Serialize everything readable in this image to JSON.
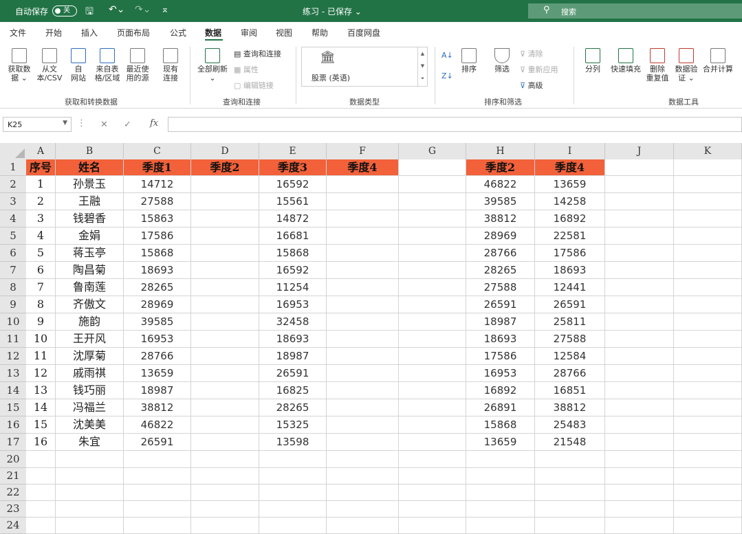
{
  "title_bar": {
    "autosave_label": "自动保存",
    "toggle_state": "关",
    "document_title": "练习 - 已保存 ⌄",
    "search_placeholder": "搜索"
  },
  "menu": {
    "tabs": [
      "文件",
      "开始",
      "插入",
      "页面布局",
      "公式",
      "数据",
      "审阅",
      "视图",
      "帮助",
      "百度网盘"
    ],
    "active_tab": "数据"
  },
  "ribbon": {
    "get_data": {
      "buttons": [
        {
          "line1": "获取数",
          "line2": "据 ⌄"
        },
        {
          "line1": "从文",
          "line2": "本/CSV"
        },
        {
          "line1": "自",
          "line2": "网站"
        },
        {
          "line1": "来自表",
          "line2": "格/区域"
        },
        {
          "line1": "最近使",
          "line2": "用的源"
        },
        {
          "line1": "现有",
          "line2": "连接"
        }
      ],
      "group_label": "获取和转换数据"
    },
    "queries": {
      "refresh_all_line1": "全部刷新",
      "refresh_all_line2": "⌄",
      "queries_connections": "查询和连接",
      "properties": "属性",
      "edit_links": "编辑链接",
      "group_label": "查询和连接"
    },
    "data_types": {
      "stock_label": "股票 (英语)",
      "group_label": "数据类型"
    },
    "sort_filter": {
      "sort": "排序",
      "filter": "筛选",
      "clear": "清除",
      "reapply": "重新应用",
      "advanced": "高级",
      "group_label": "排序和筛选"
    },
    "data_tools": {
      "text_to_columns": "分列",
      "flash_fill": "快速填充",
      "remove_dup_line1": "删除",
      "remove_dup_line2": "重复值",
      "validation_line1": "数据验",
      "validation_line2": "证 ⌄",
      "consolidate": "合并计算",
      "group_label": "数据工具"
    }
  },
  "formula_bar": {
    "name_box": "K25",
    "fx": "fx",
    "formula": ""
  },
  "sheet": {
    "columns": [
      "A",
      "B",
      "C",
      "D",
      "E",
      "F",
      "G",
      "H",
      "I",
      "J",
      "K"
    ],
    "row_numbers": [
      "1",
      "2",
      "3",
      "4",
      "5",
      "6",
      "7",
      "8",
      "9",
      "10",
      "11",
      "12",
      "13",
      "14",
      "15",
      "16",
      "17",
      "20",
      "21",
      "22",
      "23",
      "24"
    ],
    "header_row": [
      "序号",
      "姓名",
      "季度1",
      "季度2",
      "季度3",
      "季度4",
      "",
      "季度2",
      "季度4",
      "",
      ""
    ],
    "header_fill": "#f2613a",
    "data_rows": [
      [
        "1",
        "孙景玉",
        "14712",
        "",
        "16592",
        "",
        "",
        "46822",
        "13659",
        "",
        ""
      ],
      [
        "2",
        "王融",
        "27588",
        "",
        "15561",
        "",
        "",
        "39585",
        "14258",
        "",
        ""
      ],
      [
        "3",
        "钱碧香",
        "15863",
        "",
        "14872",
        "",
        "",
        "38812",
        "16892",
        "",
        ""
      ],
      [
        "4",
        "金娟",
        "17586",
        "",
        "16681",
        "",
        "",
        "28969",
        "22581",
        "",
        ""
      ],
      [
        "5",
        "蒋玉亭",
        "15868",
        "",
        "15868",
        "",
        "",
        "28766",
        "17586",
        "",
        ""
      ],
      [
        "6",
        "陶昌菊",
        "18693",
        "",
        "16592",
        "",
        "",
        "28265",
        "18693",
        "",
        ""
      ],
      [
        "7",
        "鲁南莲",
        "28265",
        "",
        "11254",
        "",
        "",
        "27588",
        "12441",
        "",
        ""
      ],
      [
        "8",
        "齐傲文",
        "28969",
        "",
        "16953",
        "",
        "",
        "26591",
        "26591",
        "",
        ""
      ],
      [
        "9",
        "施韵",
        "39585",
        "",
        "32458",
        "",
        "",
        "18987",
        "25811",
        "",
        ""
      ],
      [
        "10",
        "王开风",
        "16953",
        "",
        "18693",
        "",
        "",
        "18693",
        "27588",
        "",
        ""
      ],
      [
        "11",
        "沈厚菊",
        "28766",
        "",
        "18987",
        "",
        "",
        "17586",
        "12584",
        "",
        ""
      ],
      [
        "12",
        "戚雨祺",
        "13659",
        "",
        "26591",
        "",
        "",
        "16953",
        "28766",
        "",
        ""
      ],
      [
        "13",
        "钱巧丽",
        "18987",
        "",
        "16825",
        "",
        "",
        "16892",
        "16851",
        "",
        ""
      ],
      [
        "14",
        "冯福兰",
        "38812",
        "",
        "28265",
        "",
        "",
        "26891",
        "38812",
        "",
        ""
      ],
      [
        "15",
        "沈美美",
        "46822",
        "",
        "15325",
        "",
        "",
        "15868",
        "25483",
        "",
        ""
      ],
      [
        "16",
        "朱宜",
        "26591",
        "",
        "13598",
        "",
        "",
        "13659",
        "21548",
        "",
        ""
      ]
    ]
  }
}
